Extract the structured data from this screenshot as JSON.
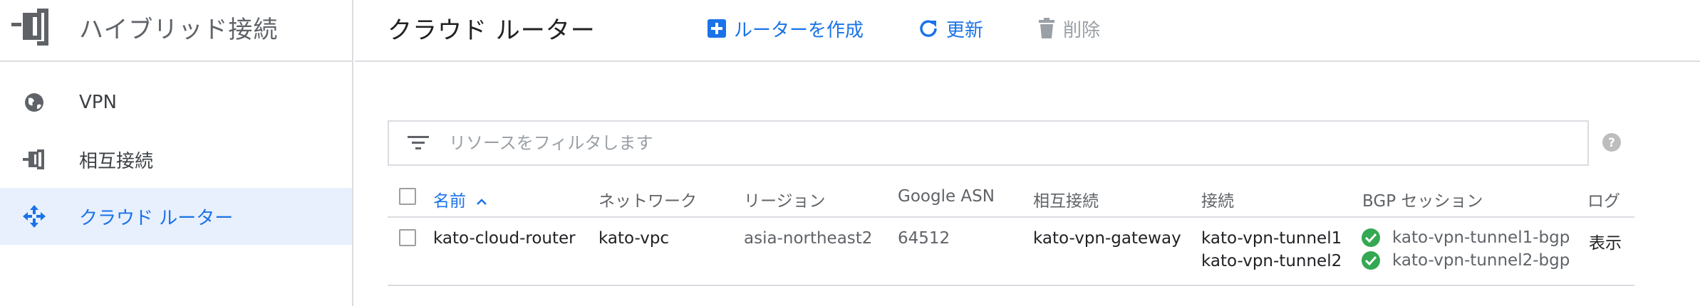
{
  "sidebar": {
    "title": "ハイブリッド接続",
    "items": [
      {
        "label": "VPN",
        "icon": "globe-icon"
      },
      {
        "label": "相互接続",
        "icon": "interconnect-icon"
      },
      {
        "label": "クラウド ルーター",
        "icon": "cloud-router-icon",
        "active": true
      }
    ]
  },
  "toolbar": {
    "title": "クラウド ルーター",
    "create_label": "ルーターを作成",
    "refresh_label": "更新",
    "delete_label": "削除"
  },
  "filter": {
    "placeholder": "リソースをフィルタします"
  },
  "table": {
    "headers": {
      "name": "名前",
      "network": "ネットワーク",
      "region": "リージョン",
      "asn": "Google ASN",
      "interconnect": "相互接続",
      "connection": "接続",
      "bgp": "BGP セッション",
      "log": "ログ"
    },
    "rows": [
      {
        "name": "kato-cloud-router",
        "network": "kato-vpc",
        "region": "asia-northeast2",
        "asn": "64512",
        "interconnect": "kato-vpn-gateway",
        "connections": [
          "kato-vpn-tunnel1",
          "kato-vpn-tunnel2"
        ],
        "bgp_sessions": [
          "kato-vpn-tunnel1-bgp",
          "kato-vpn-tunnel2-bgp"
        ],
        "log": "表示"
      }
    ]
  },
  "colors": {
    "accent": "#1a73e8",
    "success": "#34a853",
    "border": "#dadce0",
    "active_bg": "#e8f0fe"
  }
}
